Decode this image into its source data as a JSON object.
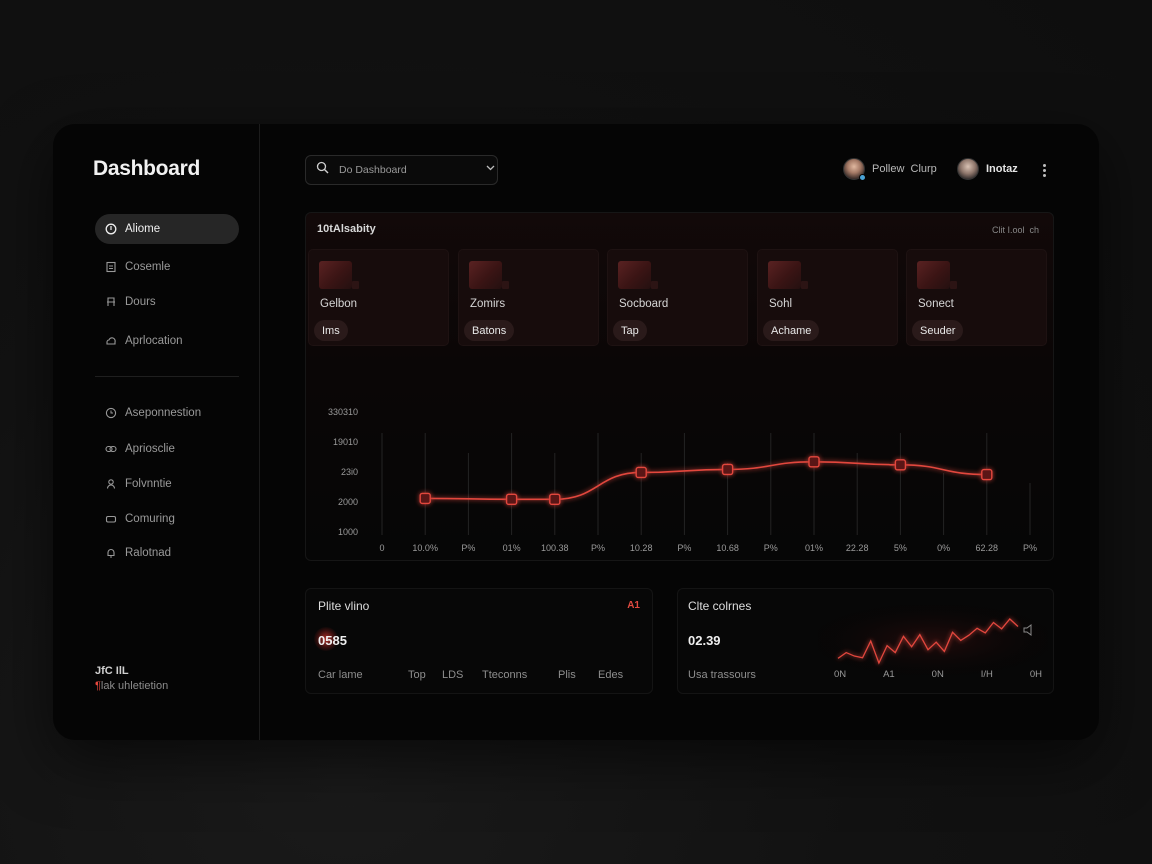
{
  "sidebar": {
    "title": "Dashboard",
    "items": [
      {
        "label": "Aliome",
        "active": true,
        "icon": "info-circle-icon"
      },
      {
        "label": "Cosemle",
        "active": false,
        "icon": "document-icon"
      },
      {
        "label": "Dours",
        "active": false,
        "icon": "chair-icon"
      },
      {
        "label": "Aprlocation",
        "active": false,
        "icon": "cloud-icon"
      },
      {
        "label": "Aseponnestion",
        "active": false,
        "icon": "clock-icon"
      },
      {
        "label": "Apriosclie",
        "active": false,
        "icon": "link-icon"
      },
      {
        "label": "Folvnntie",
        "active": false,
        "icon": "user-icon"
      },
      {
        "label": "Comuring",
        "active": false,
        "icon": "card-icon"
      },
      {
        "label": "Ralotnad",
        "active": false,
        "icon": "bell-icon"
      }
    ],
    "footer": {
      "line1": "JfC IlL",
      "line2_prefix": "¶",
      "line2_text": "lak uhletietion"
    }
  },
  "header": {
    "search_placeholder": "Do Dashboard",
    "users": [
      {
        "name": "Pollew  Clurp"
      },
      {
        "name": "Inotaz"
      }
    ]
  },
  "panel": {
    "title": "10tAlsabity",
    "action": "Clit I.ool  ch",
    "cards": [
      {
        "label": "Gelbon",
        "pill": "Ims"
      },
      {
        "label": "Zomirs",
        "pill": "Batons"
      },
      {
        "label": "Socboard",
        "pill": "Tap"
      },
      {
        "label": "Sohl",
        "pill": "Achame"
      },
      {
        "label": "Sonect",
        "pill": "Seuder"
      }
    ]
  },
  "chart_data": {
    "type": "line",
    "y_tick_labels": [
      "330310",
      "19010",
      "23i0",
      "2000",
      "1000"
    ],
    "x_tick_labels": [
      "0",
      "10.0%",
      "P%",
      "01%",
      "100.38",
      "P%",
      "10.28",
      "P%",
      "10.68",
      "P%",
      "01%",
      "22.28",
      "5%",
      "0%",
      "62.28",
      "P%"
    ],
    "ylim": [
      1000,
      5000
    ],
    "series": [
      {
        "points": [
          [
            1,
            2200
          ],
          [
            3,
            2170
          ],
          [
            4,
            2170
          ],
          [
            6,
            3050
          ],
          [
            8,
            3150
          ],
          [
            10,
            3400
          ],
          [
            12,
            3300
          ],
          [
            14,
            2980
          ]
        ]
      }
    ],
    "color": "#e2473e",
    "grid": "vertical"
  },
  "bottom_left": {
    "title": "Plite vlino",
    "badge": "A1",
    "value": "0585",
    "labels": [
      "Car lame",
      "Top",
      "LDS",
      "Tteconns",
      "Plis",
      "Edes"
    ]
  },
  "bottom_right": {
    "title": "Clte colrnes",
    "value": "02.39",
    "caption": "Usa trassours",
    "x_tick_labels": [
      "0N",
      "A1",
      "0N",
      "I/H",
      "0H"
    ],
    "spark_values": [
      2,
      3,
      2.4,
      2.1,
      5,
      1.2,
      4.2,
      3,
      5.8,
      4,
      6.1,
      3.5,
      4.8,
      3.2,
      6.5,
      5.1,
      6,
      7.2,
      6.4,
      8.2,
      7.1,
      8.8,
      7.5
    ]
  }
}
